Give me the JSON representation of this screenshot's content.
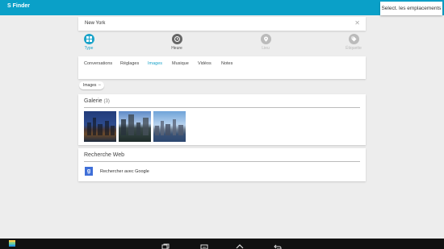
{
  "app": {
    "title": "S Finder"
  },
  "header": {
    "select_locations": "Select. les emplacements"
  },
  "search": {
    "query": "New York"
  },
  "filters": [
    {
      "label": "Type"
    },
    {
      "label": "Heure"
    },
    {
      "label": "Lieu"
    },
    {
      "label": "Étiquette"
    }
  ],
  "tabs": [
    {
      "label": "Conversations"
    },
    {
      "label": "Réglages"
    },
    {
      "label": "Images"
    },
    {
      "label": "Musique"
    },
    {
      "label": "Vidéos"
    },
    {
      "label": "Notes"
    }
  ],
  "active_tab": "Images",
  "chip": {
    "label": "Images"
  },
  "gallery": {
    "title": "Galerie",
    "count": "(3)"
  },
  "web": {
    "title": "Recherche Web",
    "google_label": "Rechercher avec Google"
  },
  "colors": {
    "accent": "#0aa0c8",
    "active_tab": "#1aa3c9",
    "background": "#ededed"
  }
}
